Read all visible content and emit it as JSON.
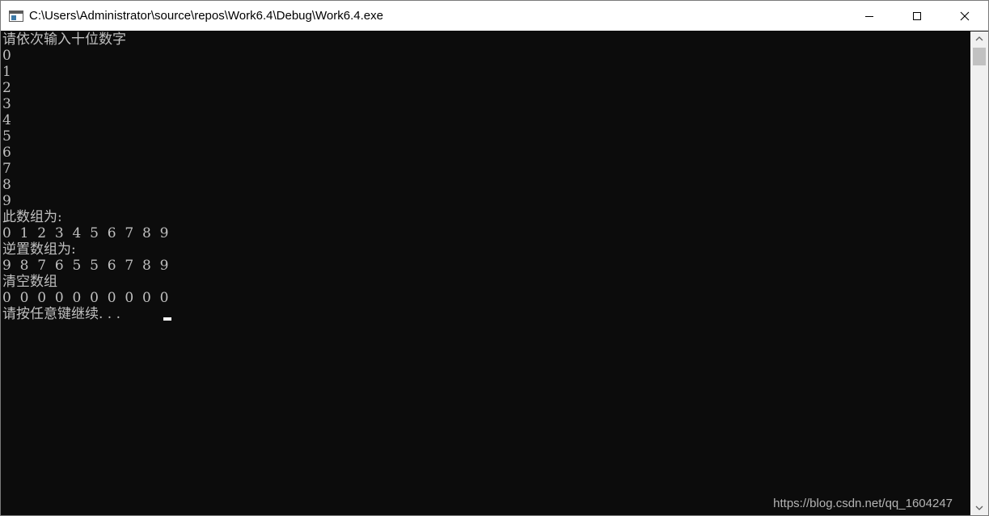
{
  "window": {
    "title": "C:\\Users\\Administrator\\source\\repos\\Work6.4\\Debug\\Work6.4.exe",
    "icon": "console-app-icon",
    "controls": [
      "minimize-icon",
      "maximize-icon",
      "close-icon"
    ]
  },
  "console": {
    "lines": [
      "请依次输入十位数字",
      "0",
      "1",
      "2",
      "3",
      "4",
      "5",
      "6",
      "7",
      "8",
      "9",
      "此数组为:",
      "0  1  2  3  4  5  6  7  8  9",
      "逆置数组为:",
      "9  8  7  6  5  5  6  7  8  9",
      "清空数组",
      "0  0  0  0  0  0  0  0  0  0",
      "请按任意键继续. . . "
    ],
    "text_color": "#c0c0c0",
    "background": "#0c0c0c"
  },
  "watermark": "https://blog.csdn.net/qq_1604247"
}
